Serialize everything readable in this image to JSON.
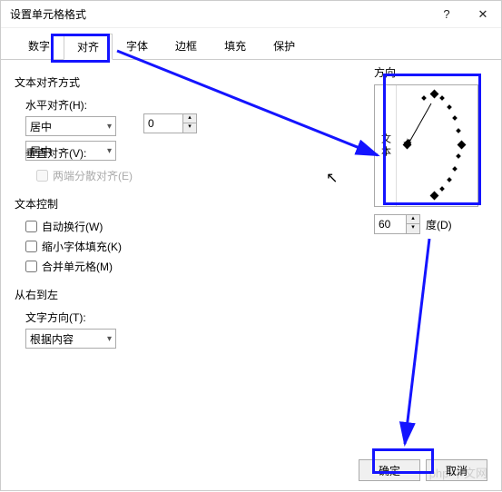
{
  "title": "设置单元格格式",
  "help_btn": "?",
  "close_btn": "✕",
  "tabs": {
    "number": "数字",
    "alignment": "对齐",
    "font": "字体",
    "border": "边框",
    "fill": "填充",
    "protect": "保护"
  },
  "text_align_section": "文本对齐方式",
  "horizontal": {
    "label": "水平对齐(H):",
    "value": "居中"
  },
  "indent": {
    "label": "缩进(I):",
    "value": "0"
  },
  "vertical": {
    "label": "垂直对齐(V):",
    "value": "居中"
  },
  "distribute_justify": "两端分散对齐(E)",
  "text_control_section": "文本控制",
  "wrap_text": "自动换行(W)",
  "shrink_fit": "缩小字体填充(K)",
  "merge_cells": "合并单元格(M)",
  "rtl_section": "从右到左",
  "text_direction": {
    "label": "文字方向(T):",
    "value": "根据内容"
  },
  "orientation": {
    "label": "方向",
    "vertical_text": "文本",
    "degrees_value": "60",
    "degrees_label": "度(D)"
  },
  "footer": {
    "ok": "确定",
    "cancel": "取消"
  },
  "watermark": "php 中文网"
}
